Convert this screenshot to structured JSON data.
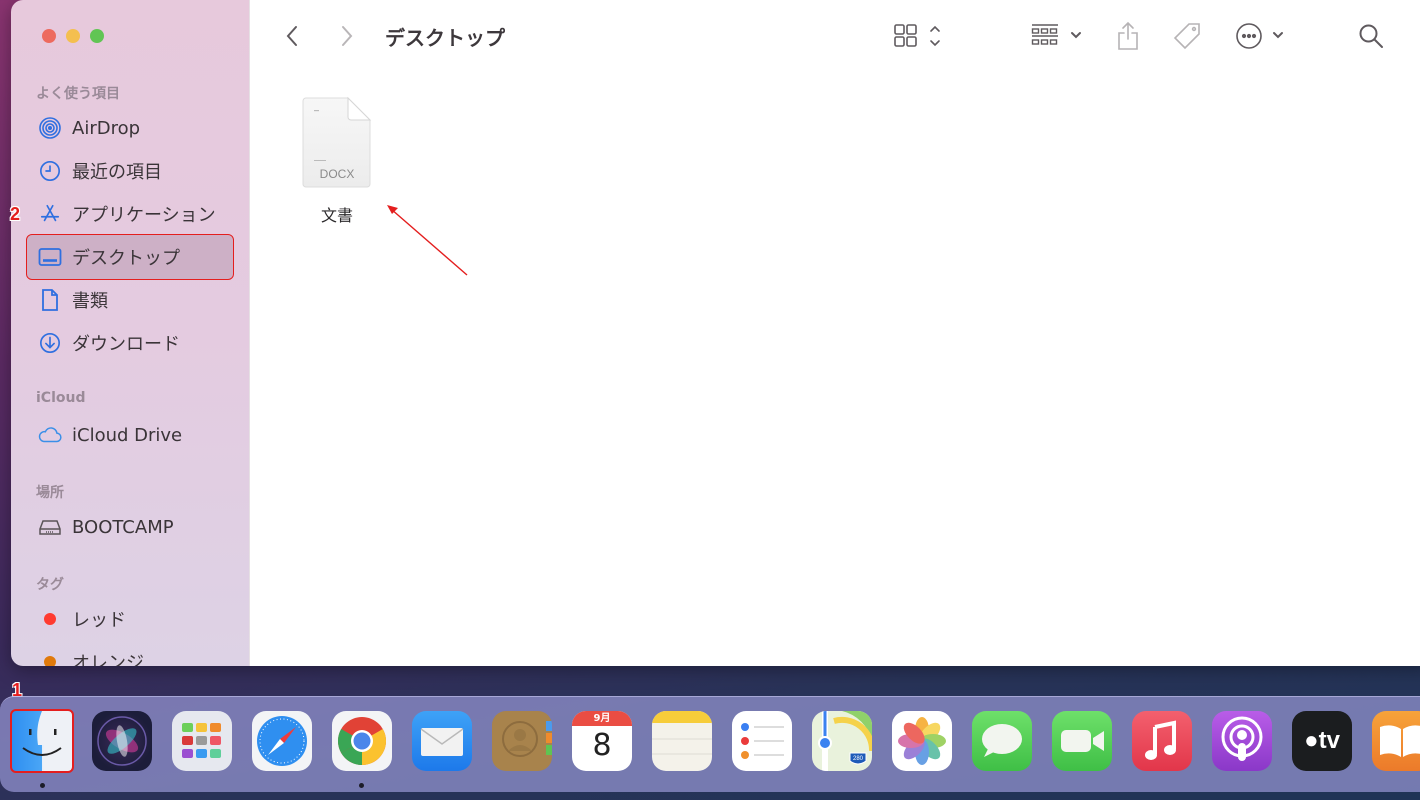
{
  "window": {
    "title": "デスクトップ",
    "traffic_lights": [
      "close",
      "minimize",
      "zoom"
    ]
  },
  "sidebar": {
    "sections": [
      {
        "header": "よく使う項目",
        "items": [
          {
            "label": "AirDrop",
            "icon": "airdrop-icon"
          },
          {
            "label": "最近の項目",
            "icon": "clock-icon"
          },
          {
            "label": "アプリケーション",
            "icon": "applications-icon"
          },
          {
            "label": "デスクトップ",
            "icon": "desktop-icon",
            "selected": true
          },
          {
            "label": "書類",
            "icon": "document-icon"
          },
          {
            "label": "ダウンロード",
            "icon": "download-icon"
          }
        ]
      },
      {
        "header": "iCloud",
        "items": [
          {
            "label": "iCloud Drive",
            "icon": "cloud-icon"
          }
        ]
      },
      {
        "header": "場所",
        "items": [
          {
            "label": "BOOTCAMP",
            "icon": "disk-icon"
          }
        ]
      },
      {
        "header": "タグ",
        "items": [
          {
            "label": "レッド",
            "color": "#ff3b30"
          },
          {
            "label": "オレンジ",
            "color": "#e07a0b"
          }
        ]
      }
    ]
  },
  "toolbar": {
    "back": "chevron-left-icon",
    "forward": "chevron-right-icon",
    "view_mode": "grid-view-icon",
    "group": "group-icon",
    "share": "share-icon",
    "tag": "tag-icon",
    "more": "ellipsis-icon",
    "search": "search-icon"
  },
  "files": [
    {
      "name": "文書",
      "type_label": "DOCX"
    }
  ],
  "annotations": {
    "step1": "1",
    "step2": "2",
    "color": "#e41e1e"
  },
  "dock": {
    "apps": [
      {
        "name": "Finder",
        "running": true
      },
      {
        "name": "Siri"
      },
      {
        "name": "Launchpad"
      },
      {
        "name": "Safari"
      },
      {
        "name": "Google Chrome",
        "running": true
      },
      {
        "name": "Mail"
      },
      {
        "name": "Contacts"
      },
      {
        "name": "Calendar",
        "month": "9月",
        "day": "8"
      },
      {
        "name": "Notes"
      },
      {
        "name": "Reminders"
      },
      {
        "name": "Maps",
        "badge": "280"
      },
      {
        "name": "Photos"
      },
      {
        "name": "Messages"
      },
      {
        "name": "FaceTime"
      },
      {
        "name": "Music"
      },
      {
        "name": "Podcasts"
      },
      {
        "name": "TV",
        "label": "tv"
      },
      {
        "name": "Books"
      }
    ]
  }
}
